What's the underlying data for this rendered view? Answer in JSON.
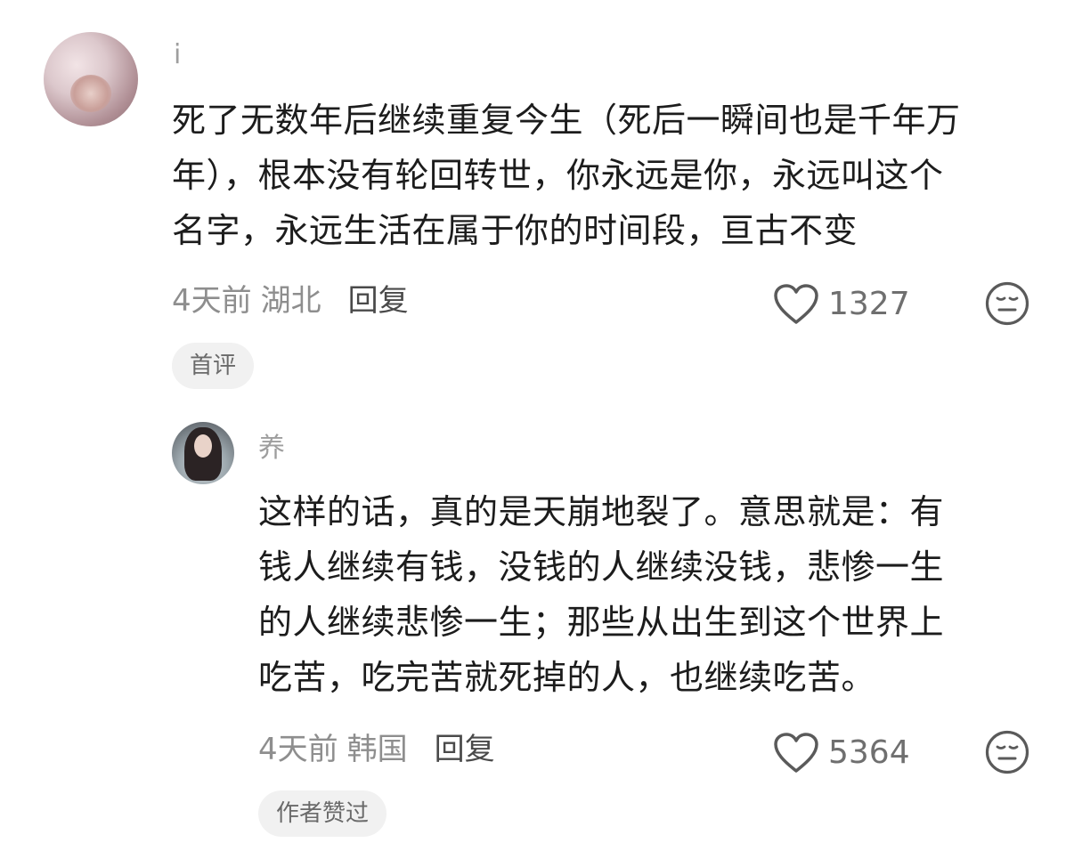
{
  "comment": {
    "username_visible": "i",
    "username_hidden": "",
    "text_lines": [
      "死了无数年后继续重复今生（死后一瞬间也是千年万",
      "年），根本没有轮回转世，你永远是你，永远叫这个",
      "名字，永远生活在属于你的时间段，亘古不变"
    ],
    "time": "4天前",
    "location": "湖北",
    "reply_label": "回复",
    "like_count": "1327",
    "badge": "首评"
  },
  "reply": {
    "username_visible": "养",
    "username_hidden": "",
    "text_lines": [
      "这样的话，真的是天崩地裂了。意思就是：有",
      "钱人继续有钱，没钱的人继续没钱，悲惨一生",
      "的人继续悲惨一生；那些从出生到这个世界上",
      "吃苦，吃完苦就死掉的人，也继续吃苦。"
    ],
    "time": "4天前",
    "location": "韩国",
    "reply_label": "回复",
    "like_count": "5364",
    "badge": "作者赞过"
  },
  "icons": {
    "like": "heart-outline-icon",
    "emoji": "expressionless-face-icon"
  },
  "colors": {
    "text_primary": "#1c1c1c",
    "text_meta": "#8e8e8e",
    "badge_bg": "#f1f1f1"
  }
}
